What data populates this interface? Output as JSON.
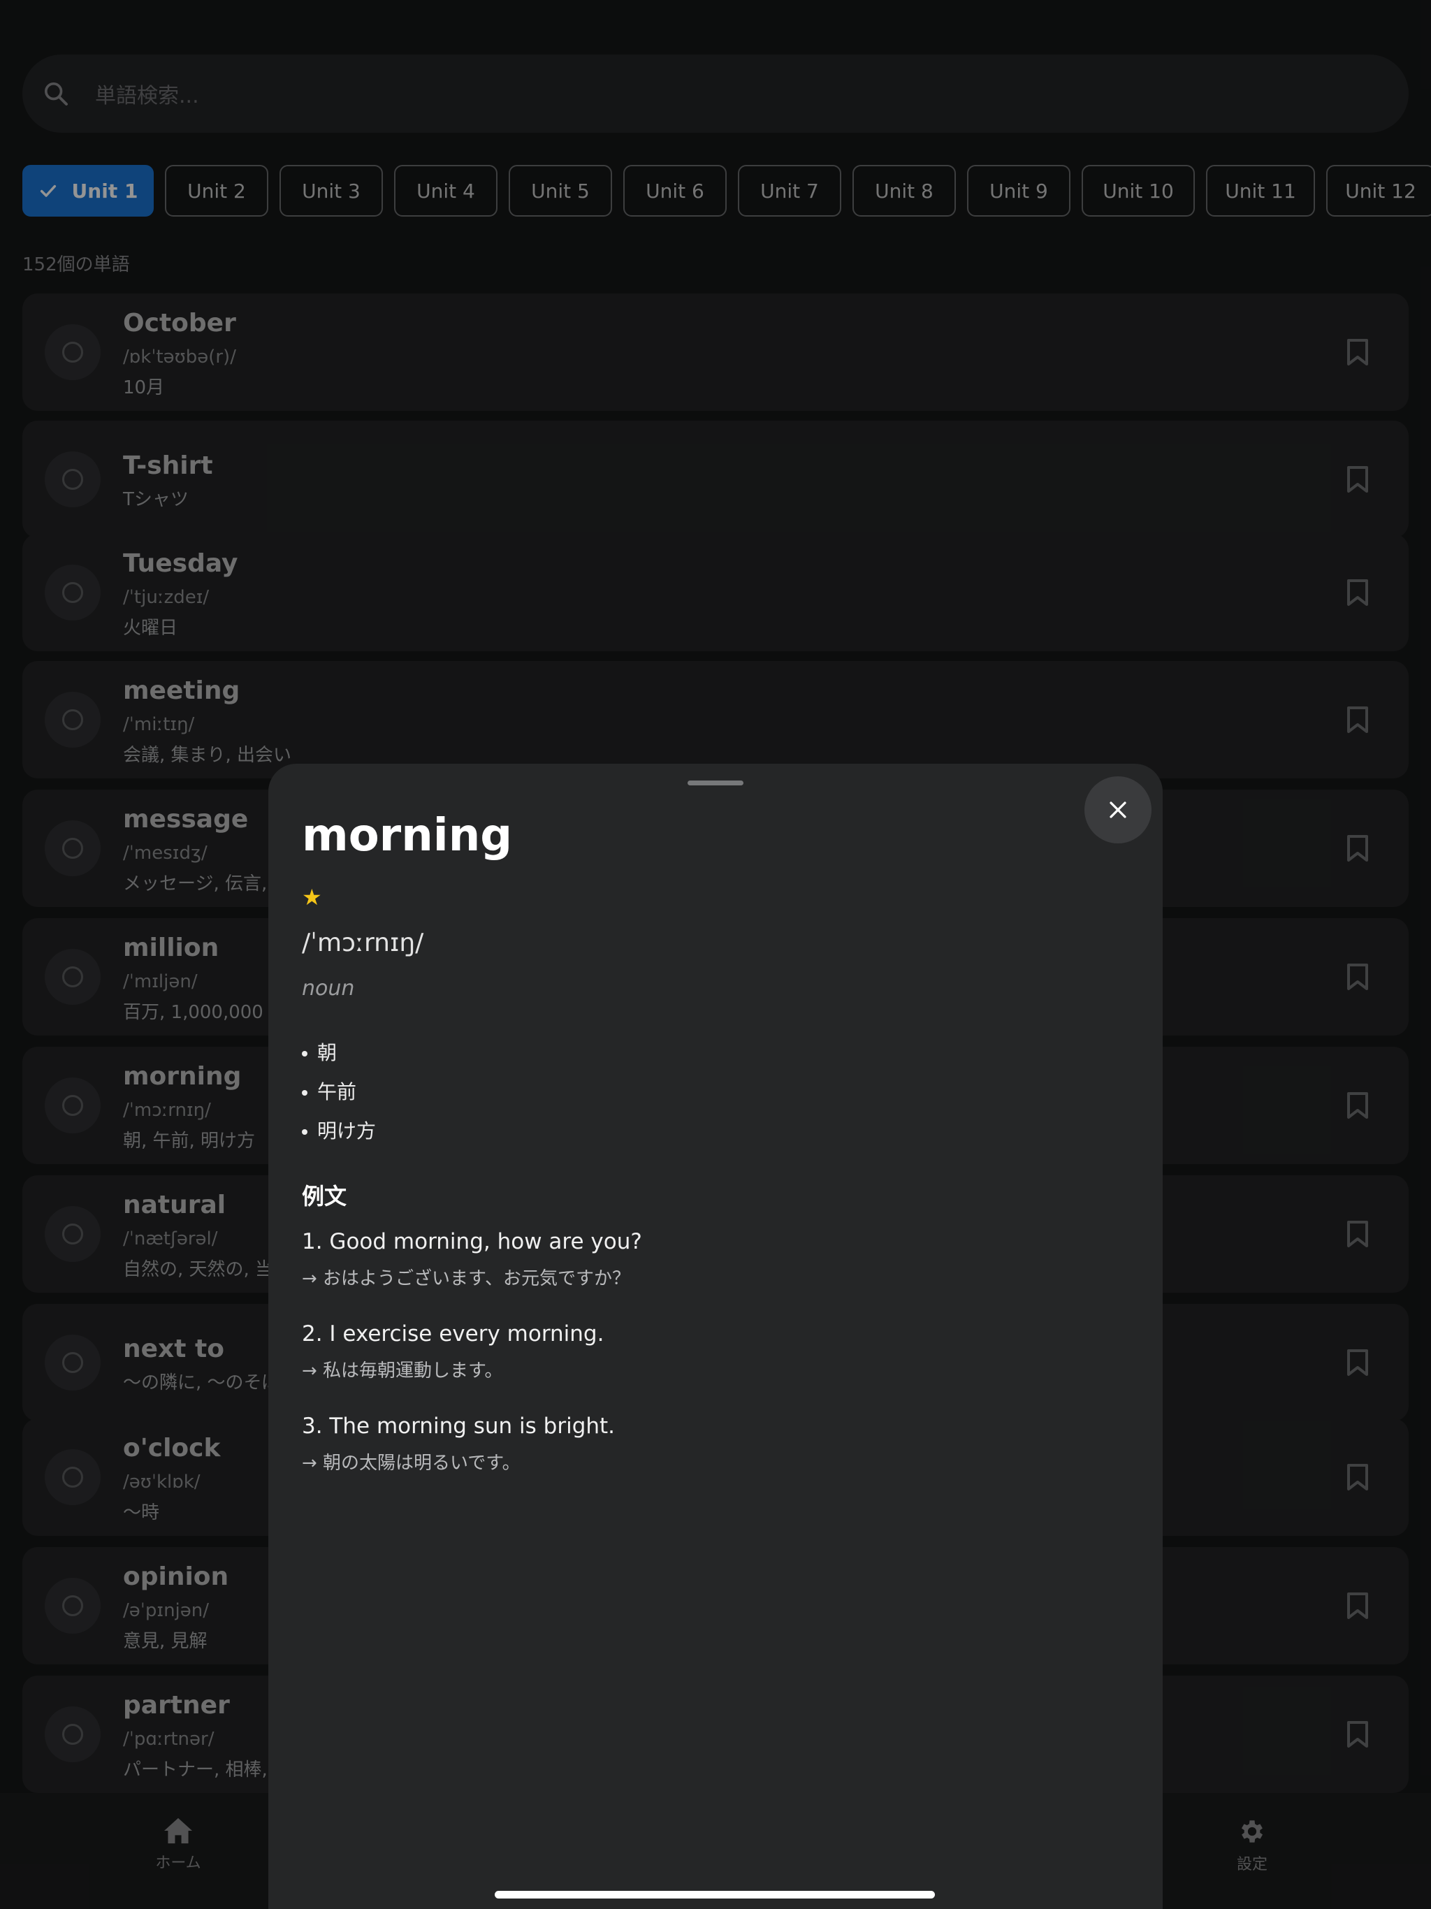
{
  "search": {
    "placeholder": "単語検索..."
  },
  "units": [
    "Unit 1",
    "Unit 2",
    "Unit 3",
    "Unit 4",
    "Unit 5",
    "Unit 6",
    "Unit 7",
    "Unit 8",
    "Unit 9",
    "Unit 10",
    "Unit 11",
    "Unit 12"
  ],
  "selected_unit": "Unit 1",
  "word_count": "152個の単語",
  "words": [
    {
      "word": "October",
      "ipa": "/ɒkˈtəʊbə(r)/",
      "meaning": "10月"
    },
    {
      "word": "T-shirt",
      "ipa": "",
      "meaning": "Tシャツ"
    },
    {
      "word": "Tuesday",
      "ipa": "/ˈtjuːzdeɪ/",
      "meaning": "火曜日"
    },
    {
      "word": "meeting",
      "ipa": "/ˈmiːtɪŋ/",
      "meaning": "会議, 集まり, 出会い"
    },
    {
      "word": "message",
      "ipa": "/ˈmesɪdʒ/",
      "meaning": "メッセージ, 伝言,"
    },
    {
      "word": "million",
      "ipa": "/ˈmɪljən/",
      "meaning": "百万, 1,000,000"
    },
    {
      "word": "morning",
      "ipa": "/ˈmɔːrnɪŋ/",
      "meaning": "朝, 午前, 明け方"
    },
    {
      "word": "natural",
      "ipa": "/ˈnætʃərəl/",
      "meaning": "自然の, 天然の, 当"
    },
    {
      "word": "next to",
      "ipa": "",
      "meaning": "～の隣に, ～のそば"
    },
    {
      "word": "o'clock",
      "ipa": "/əʊˈklɒk/",
      "meaning": "～時"
    },
    {
      "word": "opinion",
      "ipa": "/əˈpɪnjən/",
      "meaning": "意見, 見解"
    },
    {
      "word": "partner",
      "ipa": "/ˈpɑːrtnər/",
      "meaning": "パートナー, 相棒,"
    }
  ],
  "nav": {
    "home": "ホーム",
    "settings": "設定"
  },
  "detail": {
    "word": "morning",
    "star": "★",
    "ipa": "/ˈmɔːrnɪŋ/",
    "pos": "noun",
    "definitions": [
      "朝",
      "午前",
      "明け方"
    ],
    "examples_title": "例文",
    "examples": [
      {
        "en": "1. Good morning, how are you?",
        "ja": "→ おはようございます、お元気ですか？"
      },
      {
        "en": "2. I exercise every morning.",
        "ja": "→ 私は毎朝運動します。"
      },
      {
        "en": "3. The morning sun is bright.",
        "ja": "→ 朝の太陽は明るいです。"
      }
    ]
  },
  "colors": {
    "accent": "#1a74d2",
    "star": "#f5c518",
    "background": "#161718",
    "sheet": "#252627"
  }
}
